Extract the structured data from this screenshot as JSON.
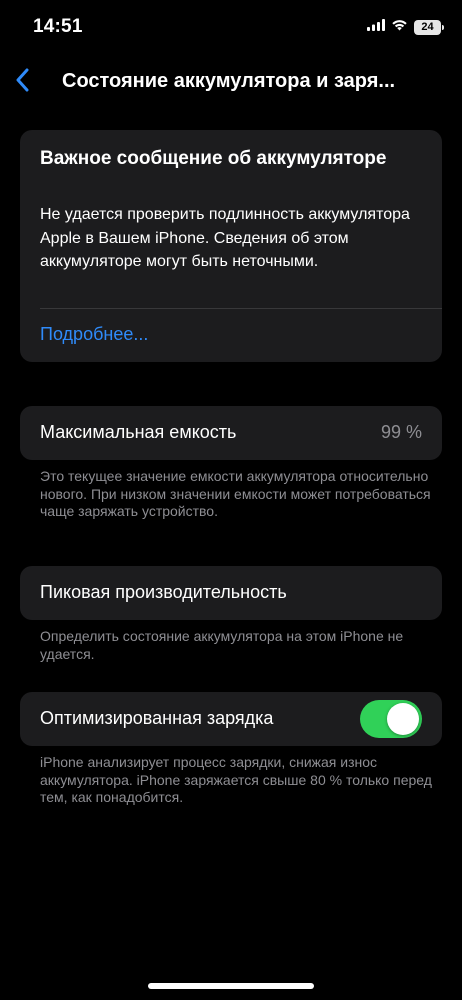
{
  "status_bar": {
    "time": "14:51",
    "battery_level": "24",
    "signal_icon": "cellular-signal-icon",
    "wifi_icon": "wifi-icon"
  },
  "nav": {
    "back_icon": "chevron-left-icon",
    "title": "Состояние аккумулятора и заря..."
  },
  "alert": {
    "title": "Важное сообщение об аккумуляторе",
    "body": "Не удается проверить подлинность аккумулятора Apple в Вашем iPhone. Сведения об этом аккумуляторе могут быть неточными.",
    "link": "Подробнее..."
  },
  "max_capacity": {
    "label": "Максимальная емкость",
    "value": "99 %",
    "footnote": "Это текущее значение емкости аккумулятора относительно нового. При низком значении емкости может потребоваться чаще заряжать устройство."
  },
  "peak_performance": {
    "label": "Пиковая производительность",
    "footnote": "Определить состояние аккумулятора на этом iPhone не удается."
  },
  "optimized_charging": {
    "label": "Оптимизированная зарядка",
    "enabled": true,
    "footnote": "iPhone анализирует процесс зарядки, снижая износ аккумулятора. iPhone заряжается свыше 80 % только перед тем, как понадобится."
  },
  "colors": {
    "background": "#000000",
    "card": "#1c1c1e",
    "accent_link": "#2f8bfa",
    "toggle_on": "#30d158",
    "secondary_text": "#8e8e93"
  }
}
